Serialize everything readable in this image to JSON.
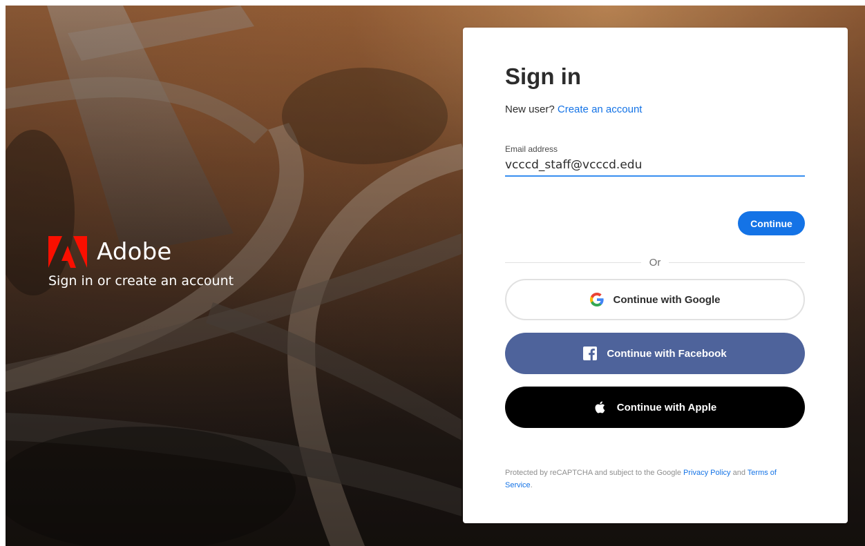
{
  "brand": {
    "name": "Adobe",
    "tagline": "Sign in or create an account",
    "logo_color": "#fa0f00"
  },
  "signin": {
    "title": "Sign in",
    "new_user_prompt": "New user?",
    "create_account_link": "Create an account",
    "email_label": "Email address",
    "email_value": "vcccd_staff@vcccd.edu",
    "continue_label": "Continue",
    "divider_text": "Or"
  },
  "social": {
    "google_label": "Continue with Google",
    "facebook_label": "Continue with Facebook",
    "apple_label": "Continue with Apple"
  },
  "legal": {
    "prefix": "Protected by reCAPTCHA and subject to the Google",
    "privacy_link": "Privacy Policy",
    "and_text": "and",
    "terms_link": "Terms of Service",
    "suffix": "."
  },
  "colors": {
    "accent": "#1473e6",
    "facebook": "#4e639b",
    "apple": "#000000",
    "input_underline": "#378ef0"
  }
}
